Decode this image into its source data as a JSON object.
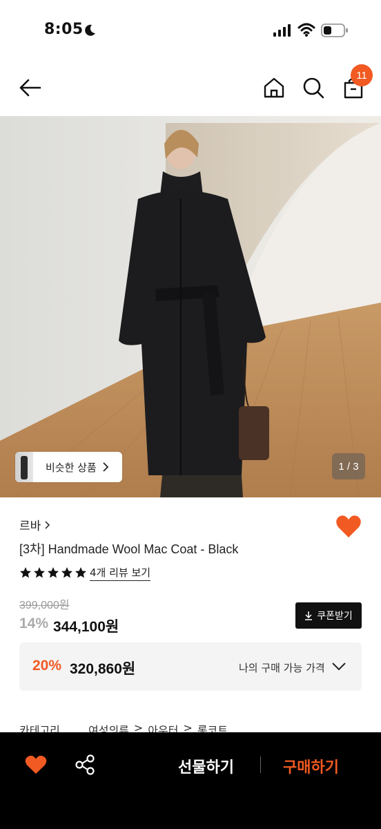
{
  "status_bar": {
    "time": "8:05"
  },
  "nav": {
    "cart_count": "11"
  },
  "gallery": {
    "similar_label": "비슷한 상품",
    "counter": "1 / 3"
  },
  "product": {
    "brand": "르바",
    "name": "[3차] Handmade Wool Mac Coat - Black",
    "rating_stars": 5,
    "review_link": "4개 리뷰 보기",
    "original_price": "399,000원",
    "discount_rate": "14%",
    "sale_price": "344,100원",
    "coupon_label": "쿠폰받기"
  },
  "my_price": {
    "discount_rate": "20%",
    "price": "320,860원",
    "label": "나의 구매 가능 가격"
  },
  "category": {
    "label": "카테고리",
    "crumbs": [
      "여성의류",
      "아우터",
      "롱코트"
    ]
  },
  "bottom_bar": {
    "gift_label": "선물하기",
    "buy_label": "구매하기"
  },
  "colors": {
    "accent": "#f15a22",
    "heart": "#f15a22",
    "bottom_bar": "#000000"
  }
}
